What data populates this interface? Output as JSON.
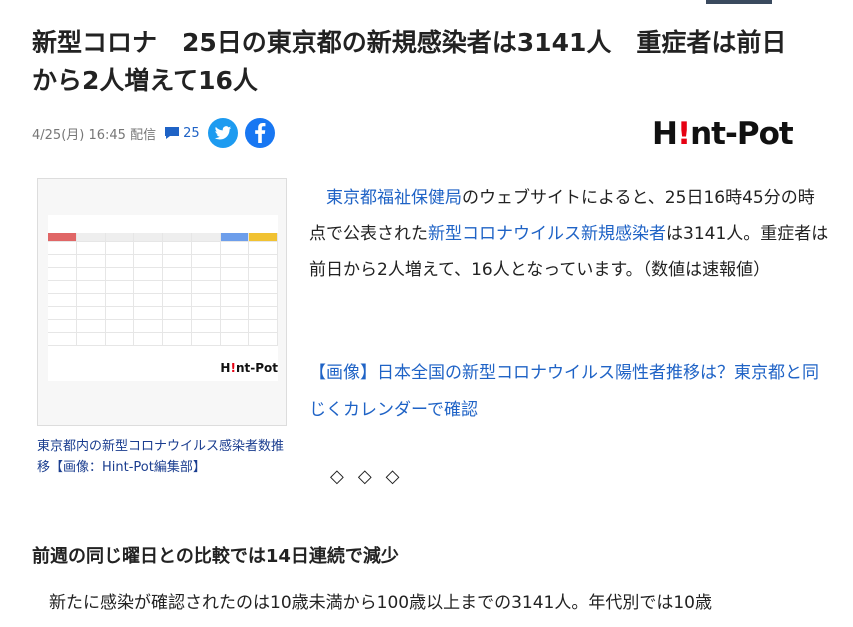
{
  "article": {
    "title": "新型コロナ　25日の東京都の新規感染者は3141人　重症者は前日\nから2人増えて16人",
    "date": "4/25(月) 16:45 配信",
    "comment_count": "25",
    "publisher_logo": {
      "pre": "H",
      "mark": "!",
      "post": "nt-Pot"
    },
    "image_caption": "東京都内の新型コロナウイルス感染者数推移【画像：Hint-Pot編集部】",
    "body": {
      "link1": "東京都福祉保健局",
      "text1": "のウェブサイトによると、25日16時45分の時点で公表された",
      "link2": "新型コロナウイルス新規感染者",
      "text2": "は3141人。重症者は前日から2人増えて、16人となっています。（数値は速報値）"
    },
    "related_link": "【画像】日本全国の新型コロナウイルス陽性者推移は？東京都と同じくカレンダーで確認",
    "divider": "◇◇◇",
    "section_heading": "前週の同じ曜日との比較では14日連続で減少",
    "section_paragraph": "新たに感染が確認されたのは10歳未満から100歳以上までの3141人。年代別では10歳"
  },
  "colors": {
    "accent_link": "#1f63c6",
    "twitter": "#1d9bf0",
    "facebook": "#1877f2",
    "logo_red": "#e60012"
  },
  "icons": [
    "comment-icon",
    "twitter-icon",
    "facebook-icon"
  ]
}
